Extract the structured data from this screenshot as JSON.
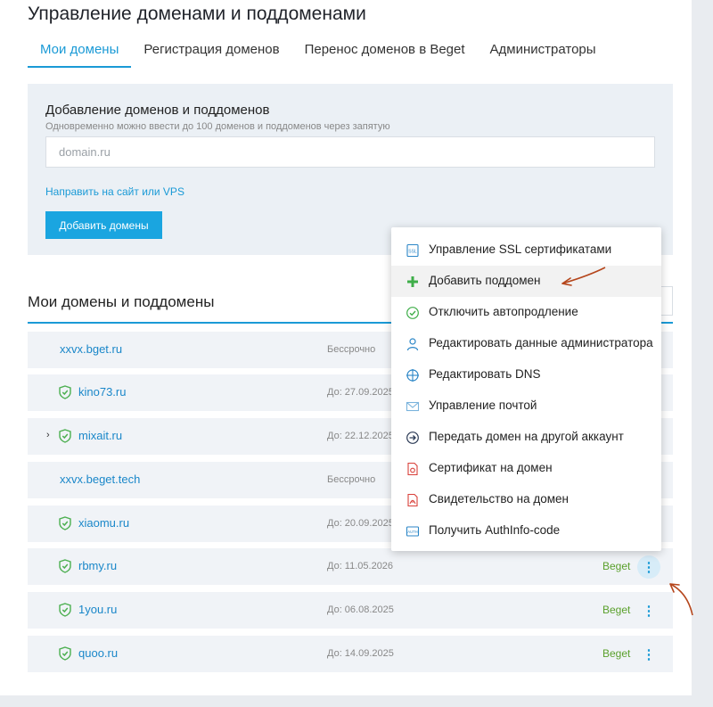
{
  "page": {
    "title": "Управление доменами и поддоменами"
  },
  "tabs": [
    {
      "label": "Мои домены",
      "active": true
    },
    {
      "label": "Регистрация доменов",
      "active": false
    },
    {
      "label": "Перенос доменов в Beget",
      "active": false
    },
    {
      "label": "Администраторы",
      "active": false
    }
  ],
  "add_panel": {
    "title": "Добавление доменов и поддоменов",
    "hint": "Одновременно можно ввести до 100 доменов и поддоменов через запятую",
    "input_placeholder": "domain.ru",
    "input_value": "",
    "link_label": "Направить на сайт или VPS",
    "button_label": "Добавить домены"
  },
  "list": {
    "title": "Мои домены и поддомены",
    "accent_color": "#1a9ad6",
    "rows": [
      {
        "domain": "xxvx.bget.ru",
        "expiry": "Бессрочно",
        "registrar": "",
        "ssl": false,
        "expandable": false
      },
      {
        "domain": "kino73.ru",
        "expiry": "До: 27.09.2025",
        "registrar": "",
        "ssl": true,
        "expandable": false
      },
      {
        "domain": "mixait.ru",
        "expiry": "До: 22.12.2025",
        "registrar": "",
        "ssl": true,
        "expandable": true
      },
      {
        "domain": "xxvx.beget.tech",
        "expiry": "Бессрочно",
        "registrar": "",
        "ssl": false,
        "expandable": false
      },
      {
        "domain": "xiaomu.ru",
        "expiry": "До: 20.09.2025",
        "registrar": "",
        "ssl": true,
        "expandable": false
      },
      {
        "domain": "rbmy.ru",
        "expiry": "До: 11.05.2026",
        "registrar": "Beget",
        "ssl": true,
        "expandable": false,
        "menu_open": true
      },
      {
        "domain": "1you.ru",
        "expiry": "До: 06.08.2025",
        "registrar": "Beget",
        "ssl": true,
        "expandable": false
      },
      {
        "domain": "quoo.ru",
        "expiry": "До: 14.09.2025",
        "registrar": "Beget",
        "ssl": true,
        "expandable": false
      }
    ]
  },
  "context_menu": {
    "items": [
      {
        "label": "Управление SSL сертификатами",
        "icon": "ssl-icon"
      },
      {
        "label": "Добавить поддомен",
        "icon": "plus-icon",
        "highlighted": true
      },
      {
        "label": "Отключить автопродление",
        "icon": "check-circle-icon"
      },
      {
        "label": "Редактировать данные администратора",
        "icon": "user-icon"
      },
      {
        "label": "Редактировать DNS",
        "icon": "dns-crosshair-icon"
      },
      {
        "label": "Управление почтой",
        "icon": "mail-icon"
      },
      {
        "label": "Передать домен на другой аккаунт",
        "icon": "transfer-arrow-icon"
      },
      {
        "label": "Сертификат на домен",
        "icon": "certificate-doc-icon"
      },
      {
        "label": "Свидетельство на домен",
        "icon": "pdf-doc-icon"
      },
      {
        "label": "Получить AuthInfo-code",
        "icon": "auth-code-icon"
      }
    ]
  },
  "colors": {
    "brand_blue": "#1a9ad6",
    "registrar_green": "#5aa02c",
    "annotation_arrow": "#b5461c"
  }
}
